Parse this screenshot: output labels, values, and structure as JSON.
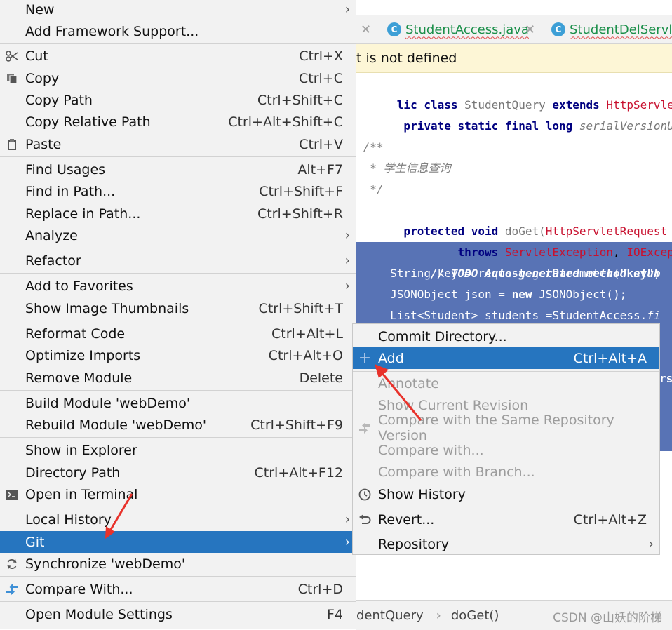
{
  "editor": {
    "tabs": [
      {
        "label": "StudentAccess.java"
      },
      {
        "label": "StudentDelServle"
      }
    ],
    "tab_icon": "C",
    "warning": "t is not defined",
    "code_lines": [
      "lic class StudentQuery extends HttpServlet {",
      " private static final long serialVersionUID =",
      "",
      " /**",
      "  * 学生信息查询",
      "  */",
      " protected void doGet(HttpServletRequest requ",
      "         throws ServletException, IOException",
      "     // TODO Auto-generated method stub",
      "     String key = request.getParameter(\"key\")",
      "     JSONObject json = new JSONObject();",
      "     List<Student> students =StudentAccess.fi"
    ],
    "side_fragments": [
      ";",
      "rs"
    ],
    "breadcrumb": [
      "dentQuery",
      "doGet()"
    ],
    "watermark": "CSDN @山妖的阶梯"
  },
  "context_menu": {
    "items": [
      {
        "label": "New",
        "shortcut": "",
        "submenu": true,
        "icon": ""
      },
      {
        "label": "Add Framework Support...",
        "shortcut": "",
        "submenu": false,
        "icon": ""
      },
      {
        "label": "Cut",
        "shortcut": "Ctrl+X",
        "submenu": false,
        "icon": "scissors-icon"
      },
      {
        "label": "Copy",
        "shortcut": "Ctrl+C",
        "submenu": false,
        "icon": "copy-icon"
      },
      {
        "label": "Copy Path",
        "shortcut": "Ctrl+Shift+C",
        "submenu": false,
        "icon": ""
      },
      {
        "label": "Copy Relative Path",
        "shortcut": "Ctrl+Alt+Shift+C",
        "submenu": false,
        "icon": ""
      },
      {
        "label": "Paste",
        "shortcut": "Ctrl+V",
        "submenu": false,
        "icon": "paste-icon"
      },
      {
        "label": "Find Usages",
        "shortcut": "Alt+F7",
        "submenu": false,
        "icon": ""
      },
      {
        "label": "Find in Path...",
        "shortcut": "Ctrl+Shift+F",
        "submenu": false,
        "icon": ""
      },
      {
        "label": "Replace in Path...",
        "shortcut": "Ctrl+Shift+R",
        "submenu": false,
        "icon": ""
      },
      {
        "label": "Analyze",
        "shortcut": "",
        "submenu": true,
        "icon": ""
      },
      {
        "label": "Refactor",
        "shortcut": "",
        "submenu": true,
        "icon": ""
      },
      {
        "label": "Add to Favorites",
        "shortcut": "",
        "submenu": true,
        "icon": ""
      },
      {
        "label": "Show Image Thumbnails",
        "shortcut": "Ctrl+Shift+T",
        "submenu": false,
        "icon": ""
      },
      {
        "label": "Reformat Code",
        "shortcut": "Ctrl+Alt+L",
        "submenu": false,
        "icon": ""
      },
      {
        "label": "Optimize Imports",
        "shortcut": "Ctrl+Alt+O",
        "submenu": false,
        "icon": ""
      },
      {
        "label": "Remove Module",
        "shortcut": "Delete",
        "submenu": false,
        "icon": ""
      },
      {
        "label": "Build Module 'webDemo'",
        "shortcut": "",
        "submenu": false,
        "icon": ""
      },
      {
        "label": "Rebuild Module 'webDemo'",
        "shortcut": "Ctrl+Shift+F9",
        "submenu": false,
        "icon": ""
      },
      {
        "label": "Show in Explorer",
        "shortcut": "",
        "submenu": false,
        "icon": ""
      },
      {
        "label": "Directory Path",
        "shortcut": "Ctrl+Alt+F12",
        "submenu": false,
        "icon": ""
      },
      {
        "label": "Open in Terminal",
        "shortcut": "",
        "submenu": false,
        "icon": "terminal-icon"
      },
      {
        "label": "Local History",
        "shortcut": "",
        "submenu": true,
        "icon": ""
      },
      {
        "label": "Git",
        "shortcut": "",
        "submenu": true,
        "icon": "",
        "active": true
      },
      {
        "label": "Synchronize 'webDemo'",
        "shortcut": "",
        "submenu": false,
        "icon": "sync-icon"
      },
      {
        "label": "Compare With...",
        "shortcut": "Ctrl+D",
        "submenu": false,
        "icon": "compare-icon"
      },
      {
        "label": "Open Module Settings",
        "shortcut": "F4",
        "submenu": false,
        "icon": ""
      }
    ]
  },
  "git_submenu": {
    "items": [
      {
        "label": "Commit Directory...",
        "shortcut": "",
        "submenu": false,
        "icon": ""
      },
      {
        "label": "Add",
        "shortcut": "Ctrl+Alt+A",
        "submenu": false,
        "icon": "plus-icon",
        "active": true
      },
      {
        "label": "Annotate",
        "shortcut": "",
        "submenu": false,
        "icon": "",
        "disabled": true
      },
      {
        "label": "Show Current Revision",
        "shortcut": "",
        "submenu": false,
        "icon": "",
        "disabled": true
      },
      {
        "label": "Compare with the Same Repository Version",
        "shortcut": "",
        "submenu": false,
        "icon": "compare-icon",
        "disabled": true
      },
      {
        "label": "Compare with...",
        "shortcut": "",
        "submenu": false,
        "icon": "",
        "disabled": true
      },
      {
        "label": "Compare with Branch...",
        "shortcut": "",
        "submenu": false,
        "icon": "",
        "disabled": true
      },
      {
        "label": "Show History",
        "shortcut": "",
        "submenu": false,
        "icon": "clock-icon"
      },
      {
        "label": "Revert...",
        "shortcut": "Ctrl+Alt+Z",
        "submenu": false,
        "icon": "undo-icon"
      },
      {
        "label": "Repository",
        "shortcut": "",
        "submenu": true,
        "icon": ""
      }
    ]
  },
  "colors": {
    "menu_bg": "#f2f2f2",
    "highlight": "#2675bf",
    "code_selection": "#5873b5",
    "annotation_arrow": "#e8322b"
  }
}
